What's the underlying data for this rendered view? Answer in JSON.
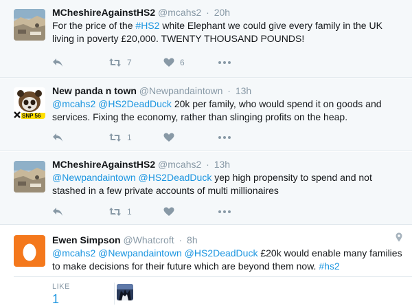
{
  "tweets": [
    {
      "fullname": "MCheshireAgainstHS2",
      "username": "@mcahs2",
      "time": "20h",
      "text_parts": [
        {
          "t": "For the price of the ",
          "link": false
        },
        {
          "t": "#HS2",
          "link": true
        },
        {
          "t": " white Elephant we could give every family in the UK living in poverty £20,000. TWENTY THOUSAND POUNDS!",
          "link": false
        }
      ],
      "retweets": "7",
      "likes": "6",
      "avatar": "landscape-avatar"
    },
    {
      "fullname": "New panda n town",
      "username": "@Newpandaintown",
      "time": "13h",
      "text_parts": [
        {
          "t": "@mcahs2",
          "link": true
        },
        {
          "t": " ",
          "link": false
        },
        {
          "t": "@HS2DeadDuck",
          "link": true
        },
        {
          "t": " 20k per family, who would spend it on goods and services. Fixing the economy, rather than slinging profits on the heap.",
          "link": false
        }
      ],
      "retweets": "1",
      "likes": "",
      "avatar": "panda-avatar",
      "avatar_badge": "SNP 56"
    },
    {
      "fullname": "MCheshireAgainstHS2",
      "username": "@mcahs2",
      "time": "13h",
      "text_parts": [
        {
          "t": "@Newpandaintown",
          "link": true
        },
        {
          "t": " ",
          "link": false
        },
        {
          "t": "@HS2DeadDuck",
          "link": true
        },
        {
          "t": " yep high propensity to spend and not stashed in a few private accounts of multi millionaires",
          "link": false
        }
      ],
      "retweets": "1",
      "likes": "",
      "avatar": "landscape-avatar"
    },
    {
      "fullname": "Ewen Simpson",
      "username": "@Whatcroft",
      "time": "8h",
      "text_parts": [
        {
          "t": "@mcahs2",
          "link": true
        },
        {
          "t": " ",
          "link": false
        },
        {
          "t": "@Newpandaintown",
          "link": true
        },
        {
          "t": " ",
          "link": false
        },
        {
          "t": "@HS2DeadDuck",
          "link": true
        },
        {
          "t": " £20k would enable many families to make decisions for their future which are beyond them now. ",
          "link": false
        },
        {
          "t": "#hs2",
          "link": true
        }
      ],
      "avatar": "egg-avatar"
    }
  ],
  "likes_section": {
    "label": "LIKE",
    "count": "1"
  },
  "colors": {
    "link": "#1b95e0",
    "muted": "#8899a6",
    "egg": "#f4781c"
  }
}
